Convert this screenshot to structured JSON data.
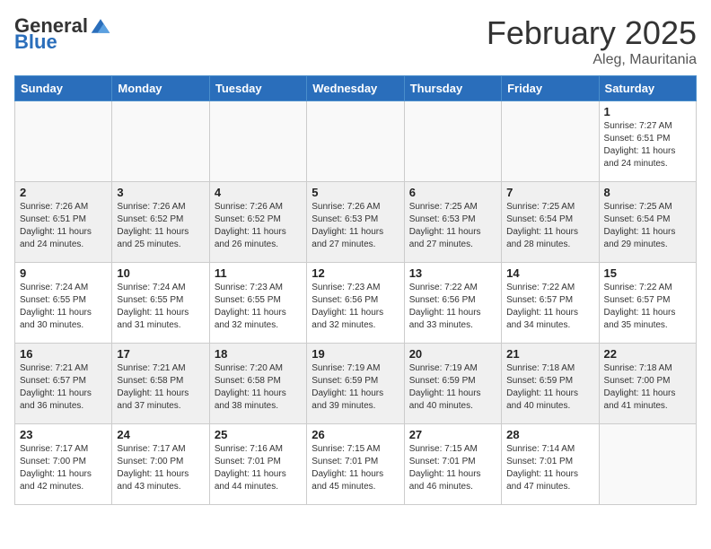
{
  "header": {
    "logo_general": "General",
    "logo_blue": "Blue",
    "month_title": "February 2025",
    "location": "Aleg, Mauritania"
  },
  "weekdays": [
    "Sunday",
    "Monday",
    "Tuesday",
    "Wednesday",
    "Thursday",
    "Friday",
    "Saturday"
  ],
  "weeks": [
    [
      {
        "day": "",
        "info": ""
      },
      {
        "day": "",
        "info": ""
      },
      {
        "day": "",
        "info": ""
      },
      {
        "day": "",
        "info": ""
      },
      {
        "day": "",
        "info": ""
      },
      {
        "day": "",
        "info": ""
      },
      {
        "day": "1",
        "info": "Sunrise: 7:27 AM\nSunset: 6:51 PM\nDaylight: 11 hours\nand 24 minutes."
      }
    ],
    [
      {
        "day": "2",
        "info": "Sunrise: 7:26 AM\nSunset: 6:51 PM\nDaylight: 11 hours\nand 24 minutes."
      },
      {
        "day": "3",
        "info": "Sunrise: 7:26 AM\nSunset: 6:52 PM\nDaylight: 11 hours\nand 25 minutes."
      },
      {
        "day": "4",
        "info": "Sunrise: 7:26 AM\nSunset: 6:52 PM\nDaylight: 11 hours\nand 26 minutes."
      },
      {
        "day": "5",
        "info": "Sunrise: 7:26 AM\nSunset: 6:53 PM\nDaylight: 11 hours\nand 27 minutes."
      },
      {
        "day": "6",
        "info": "Sunrise: 7:25 AM\nSunset: 6:53 PM\nDaylight: 11 hours\nand 27 minutes."
      },
      {
        "day": "7",
        "info": "Sunrise: 7:25 AM\nSunset: 6:54 PM\nDaylight: 11 hours\nand 28 minutes."
      },
      {
        "day": "8",
        "info": "Sunrise: 7:25 AM\nSunset: 6:54 PM\nDaylight: 11 hours\nand 29 minutes."
      }
    ],
    [
      {
        "day": "9",
        "info": "Sunrise: 7:24 AM\nSunset: 6:55 PM\nDaylight: 11 hours\nand 30 minutes."
      },
      {
        "day": "10",
        "info": "Sunrise: 7:24 AM\nSunset: 6:55 PM\nDaylight: 11 hours\nand 31 minutes."
      },
      {
        "day": "11",
        "info": "Sunrise: 7:23 AM\nSunset: 6:55 PM\nDaylight: 11 hours\nand 32 minutes."
      },
      {
        "day": "12",
        "info": "Sunrise: 7:23 AM\nSunset: 6:56 PM\nDaylight: 11 hours\nand 32 minutes."
      },
      {
        "day": "13",
        "info": "Sunrise: 7:22 AM\nSunset: 6:56 PM\nDaylight: 11 hours\nand 33 minutes."
      },
      {
        "day": "14",
        "info": "Sunrise: 7:22 AM\nSunset: 6:57 PM\nDaylight: 11 hours\nand 34 minutes."
      },
      {
        "day": "15",
        "info": "Sunrise: 7:22 AM\nSunset: 6:57 PM\nDaylight: 11 hours\nand 35 minutes."
      }
    ],
    [
      {
        "day": "16",
        "info": "Sunrise: 7:21 AM\nSunset: 6:57 PM\nDaylight: 11 hours\nand 36 minutes."
      },
      {
        "day": "17",
        "info": "Sunrise: 7:21 AM\nSunset: 6:58 PM\nDaylight: 11 hours\nand 37 minutes."
      },
      {
        "day": "18",
        "info": "Sunrise: 7:20 AM\nSunset: 6:58 PM\nDaylight: 11 hours\nand 38 minutes."
      },
      {
        "day": "19",
        "info": "Sunrise: 7:19 AM\nSunset: 6:59 PM\nDaylight: 11 hours\nand 39 minutes."
      },
      {
        "day": "20",
        "info": "Sunrise: 7:19 AM\nSunset: 6:59 PM\nDaylight: 11 hours\nand 40 minutes."
      },
      {
        "day": "21",
        "info": "Sunrise: 7:18 AM\nSunset: 6:59 PM\nDaylight: 11 hours\nand 40 minutes."
      },
      {
        "day": "22",
        "info": "Sunrise: 7:18 AM\nSunset: 7:00 PM\nDaylight: 11 hours\nand 41 minutes."
      }
    ],
    [
      {
        "day": "23",
        "info": "Sunrise: 7:17 AM\nSunset: 7:00 PM\nDaylight: 11 hours\nand 42 minutes."
      },
      {
        "day": "24",
        "info": "Sunrise: 7:17 AM\nSunset: 7:00 PM\nDaylight: 11 hours\nand 43 minutes."
      },
      {
        "day": "25",
        "info": "Sunrise: 7:16 AM\nSunset: 7:01 PM\nDaylight: 11 hours\nand 44 minutes."
      },
      {
        "day": "26",
        "info": "Sunrise: 7:15 AM\nSunset: 7:01 PM\nDaylight: 11 hours\nand 45 minutes."
      },
      {
        "day": "27",
        "info": "Sunrise: 7:15 AM\nSunset: 7:01 PM\nDaylight: 11 hours\nand 46 minutes."
      },
      {
        "day": "28",
        "info": "Sunrise: 7:14 AM\nSunset: 7:01 PM\nDaylight: 11 hours\nand 47 minutes."
      },
      {
        "day": "",
        "info": ""
      }
    ]
  ]
}
